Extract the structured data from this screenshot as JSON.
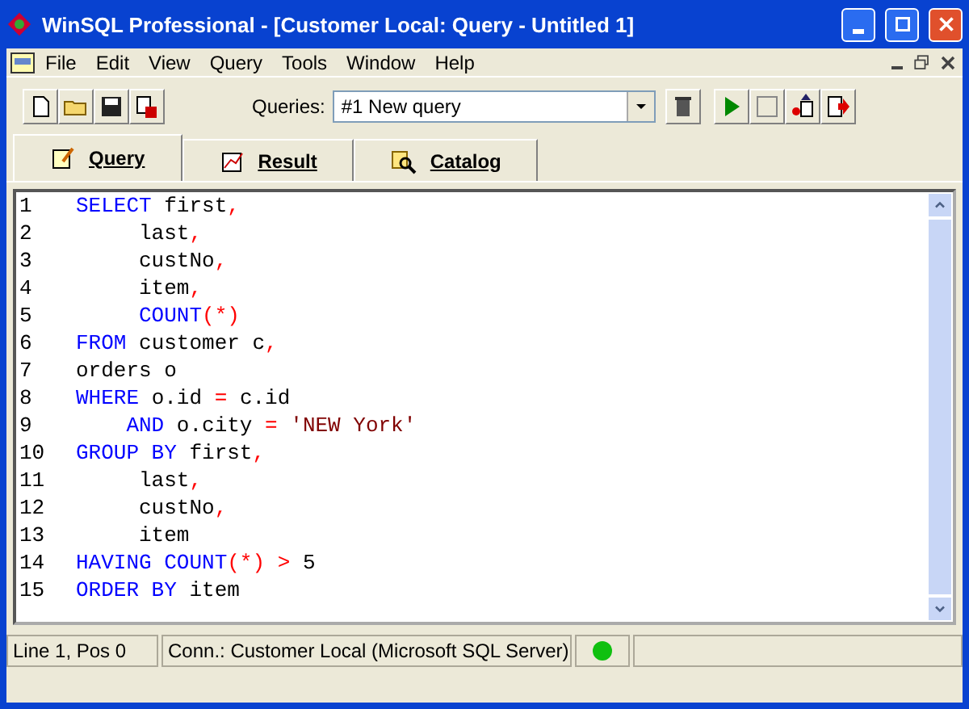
{
  "window": {
    "title": "WinSQL Professional - [Customer Local: Query - Untitled 1]"
  },
  "menu": [
    "File",
    "Edit",
    "View",
    "Query",
    "Tools",
    "Window",
    "Help"
  ],
  "toolbar": {
    "queries_label": "Queries:",
    "queries_value": "#1 New query"
  },
  "tabs": [
    {
      "label": "Query",
      "selected": true
    },
    {
      "label": "Result",
      "selected": false
    },
    {
      "label": "Catalog",
      "selected": false
    }
  ],
  "editor": {
    "lines": [
      {
        "number": "1",
        "tokens": [
          {
            "kind": "keyword",
            "text": "SELECT"
          },
          {
            "kind": "plain",
            "text": " first"
          },
          {
            "kind": "operator",
            "text": ","
          }
        ]
      },
      {
        "number": "2",
        "tokens": [
          {
            "kind": "plain",
            "text": "     last"
          },
          {
            "kind": "operator",
            "text": ","
          }
        ]
      },
      {
        "number": "3",
        "tokens": [
          {
            "kind": "plain",
            "text": "     custNo"
          },
          {
            "kind": "operator",
            "text": ","
          }
        ]
      },
      {
        "number": "4",
        "tokens": [
          {
            "kind": "plain",
            "text": "     item"
          },
          {
            "kind": "operator",
            "text": ","
          }
        ]
      },
      {
        "number": "5",
        "tokens": [
          {
            "kind": "keyword",
            "text": "     COUNT"
          },
          {
            "kind": "operator",
            "text": "(*)"
          }
        ]
      },
      {
        "number": "6",
        "tokens": [
          {
            "kind": "keyword",
            "text": "FROM"
          },
          {
            "kind": "plain",
            "text": " customer c"
          },
          {
            "kind": "operator",
            "text": ","
          }
        ]
      },
      {
        "number": "7",
        "tokens": [
          {
            "kind": "plain",
            "text": "orders o"
          }
        ]
      },
      {
        "number": "8",
        "tokens": [
          {
            "kind": "keyword",
            "text": "WHERE"
          },
          {
            "kind": "plain",
            "text": " o.id "
          },
          {
            "kind": "operator",
            "text": "="
          },
          {
            "kind": "plain",
            "text": " c.id"
          }
        ]
      },
      {
        "number": "9",
        "tokens": [
          {
            "kind": "keyword",
            "text": "    AND"
          },
          {
            "kind": "plain",
            "text": " o.city "
          },
          {
            "kind": "operator",
            "text": "= "
          },
          {
            "kind": "string",
            "text": "'NEW York'"
          }
        ]
      },
      {
        "number": "10",
        "tokens": [
          {
            "kind": "keyword",
            "text": "GROUP BY"
          },
          {
            "kind": "plain",
            "text": " first"
          },
          {
            "kind": "operator",
            "text": ","
          }
        ]
      },
      {
        "number": "11",
        "tokens": [
          {
            "kind": "plain",
            "text": "     last"
          },
          {
            "kind": "operator",
            "text": ","
          }
        ]
      },
      {
        "number": "12",
        "tokens": [
          {
            "kind": "plain",
            "text": "     custNo"
          },
          {
            "kind": "operator",
            "text": ","
          }
        ]
      },
      {
        "number": "13",
        "tokens": [
          {
            "kind": "plain",
            "text": "     item"
          }
        ]
      },
      {
        "number": "14",
        "tokens": [
          {
            "kind": "keyword",
            "text": "HAVING COUNT"
          },
          {
            "kind": "operator",
            "text": "(*) >"
          },
          {
            "kind": "plain",
            "text": " 5"
          }
        ]
      },
      {
        "number": "15",
        "tokens": [
          {
            "kind": "keyword",
            "text": "ORDER BY"
          },
          {
            "kind": "plain",
            "text": " item"
          }
        ]
      }
    ]
  },
  "status_bar": {
    "position": "Line 1, Pos 0",
    "connection": "Conn.: Customer Local (Microsoft SQL Server)",
    "connected": true
  }
}
